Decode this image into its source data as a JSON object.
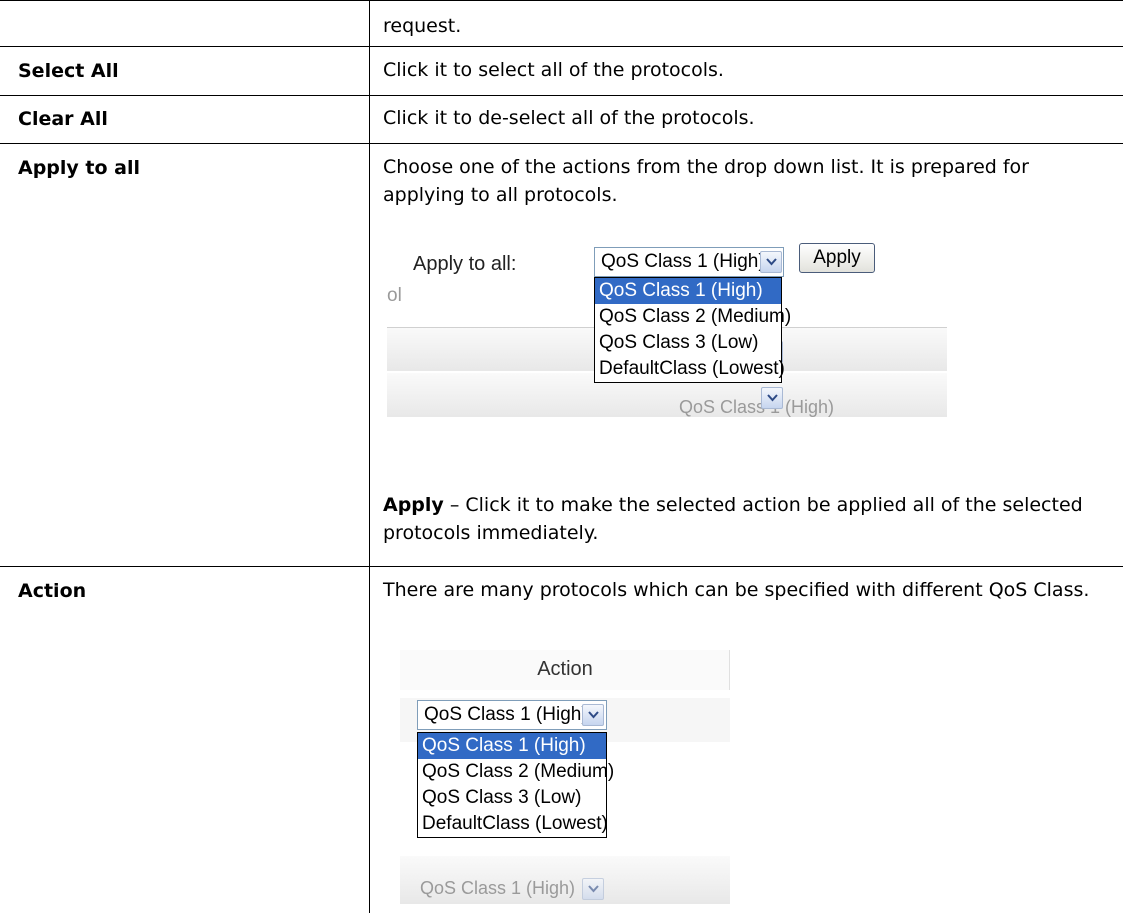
{
  "rows": [
    {
      "label": "",
      "description": "request."
    },
    {
      "label": "Select All",
      "description": "Click it to select all of the protocols."
    },
    {
      "label": "Clear All",
      "description": "Click it to de-select all of the protocols."
    },
    {
      "label": "Apply to all",
      "description": "Choose one of the actions from the drop down list. It is prepared for applying to all protocols.",
      "note_bold": "Apply",
      "note_text": " – Click it to make the selected action be applied all of the selected protocols immediately."
    },
    {
      "label": "Action",
      "description": "There are many protocols which can be specified with different QoS Class."
    }
  ],
  "apply_shot": {
    "label": "Apply to all:",
    "selected": "QoS Class 1 (High)",
    "button": "Apply",
    "partial_col": "ol",
    "partial_bg1": ")",
    "partial_bg2": "QoS Class 1 (High)",
    "options": [
      "QoS Class 1 (High)",
      "QoS Class 2 (Medium)",
      "QoS Class 3 (Low)",
      "DefaultClass (Lowest)"
    ]
  },
  "action_shot": {
    "header": "Action",
    "selected": "QoS Class 1 (High)",
    "partial_bg": "QoS Class 1 (High)",
    "options": [
      "QoS Class 1 (High)",
      "QoS Class 2 (Medium)",
      "QoS Class 3 (Low)",
      "DefaultClass (Lowest)"
    ]
  }
}
